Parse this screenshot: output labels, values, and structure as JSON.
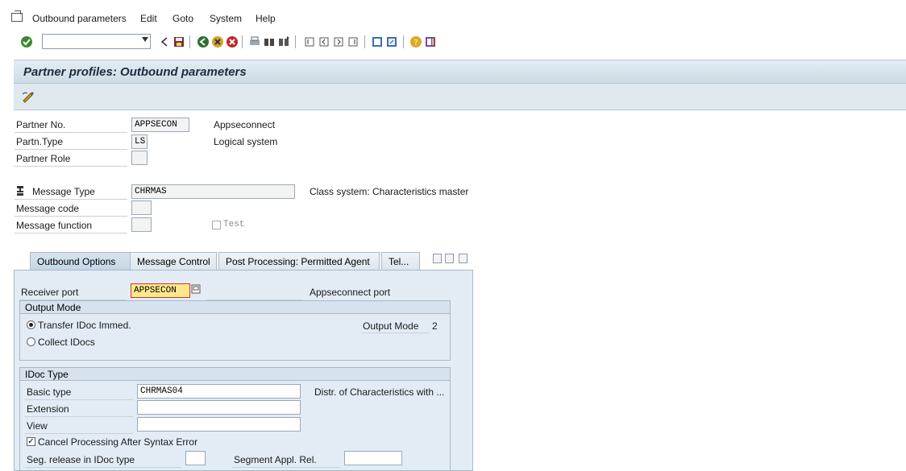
{
  "menu": {
    "items": [
      "Outbound parameters",
      "Edit",
      "Goto",
      "System",
      "Help"
    ]
  },
  "title": "Partner profiles: Outbound parameters",
  "header_fields": {
    "partner_no_label": "Partner No.",
    "partner_no_value": "APPSECON",
    "partner_no_desc": "Appseconnect",
    "partn_type_label": "Partn.Type",
    "partn_type_value": "LS",
    "partn_type_desc": "Logical system",
    "partner_role_label": "Partner Role",
    "partner_role_value": "",
    "message_type_label": "Message Type",
    "message_type_value": "CHRMAS",
    "message_type_desc": "Class system: Characteristics master",
    "message_code_label": "Message code",
    "message_code_value": "",
    "message_function_label": "Message function",
    "message_function_value": "",
    "test_label": "Test"
  },
  "tabs": [
    "Outbound Options",
    "Message Control",
    "Post Processing: Permitted Agent",
    "Tel..."
  ],
  "outbound_options": {
    "receiver_port_label": "Receiver port",
    "receiver_port_value": "APPSECON",
    "receiver_port_desc": "Appseconnect port",
    "output_mode_group": "Output Mode",
    "transfer_label": "Transfer IDoc Immed.",
    "collect_label": "Collect IDocs",
    "output_mode_label": "Output Mode",
    "output_mode_value": "2",
    "idoc_type_group": "IDoc Type",
    "basic_type_label": "Basic type",
    "basic_type_value": "CHRMAS04",
    "basic_type_desc": "Distr. of Characteristics with ...",
    "extension_label": "Extension",
    "extension_value": "",
    "view_label": "View",
    "view_value": "",
    "cancel_label": "Cancel Processing After Syntax Error",
    "seg_release_label": "Seg. release in IDoc type",
    "seg_release_value": "",
    "segment_appl_label": "Segment Appl. Rel.",
    "segment_appl_value": ""
  },
  "colors": {
    "title_bg": "#cddbe6",
    "tab_body_bg": "#e3ecf4",
    "highlight_field": "#ffe98a"
  }
}
